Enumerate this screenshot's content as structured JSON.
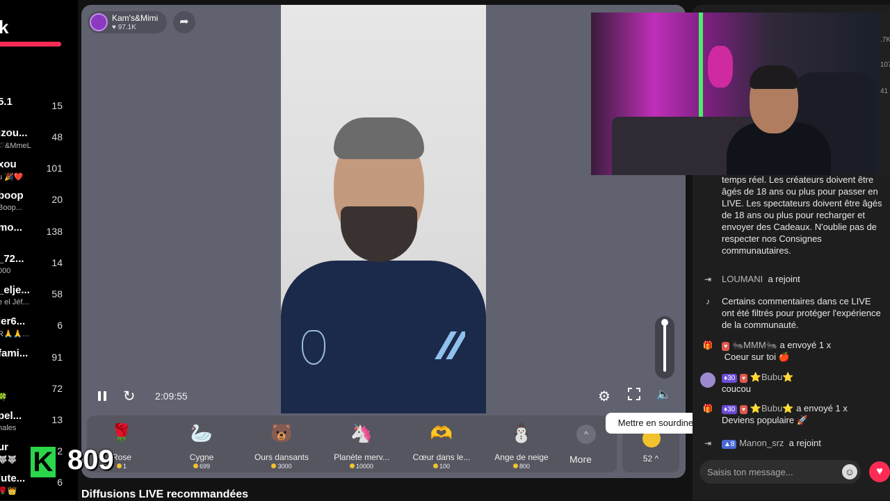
{
  "sidebar": {
    "logo": "k",
    "items": [
      {
        "name": "5.1",
        "sub": "",
        "count": "15"
      },
      {
        "name": "izou...",
        "sub": "♡&MmeL",
        "count": "48"
      },
      {
        "name": "xou",
        "sub": "u 🎉❤️",
        "count": "101"
      },
      {
        "name": "boop",
        "sub": "Boop...",
        "count": "20"
      },
      {
        "name": "mo...",
        "sub": "",
        "count": "138"
      },
      {
        "name": "_72...",
        "sub": "000",
        "count": "14"
      },
      {
        "name": "_elje...",
        "sub": "e el Jéf...",
        "count": "58"
      },
      {
        "name": "ier6...",
        "sub": "R🙏🙏...",
        "count": "6"
      },
      {
        "name": "fami...",
        "sub": "",
        "count": "91"
      },
      {
        "name": "",
        "sub": "🍀",
        "count": "72"
      },
      {
        "name": "pel...",
        "sub": "nales",
        "count": "13"
      },
      {
        "name": "ur",
        "sub": "🐺🐺",
        "count": "2"
      },
      {
        "name": "lute...",
        "sub": "🌹👑",
        "count": "6"
      }
    ],
    "overlay_badge": "K",
    "overlay_number": "809"
  },
  "video": {
    "host_name": "Kam's&Mimi",
    "host_likes": "97.1K",
    "time": "2:09:55",
    "tooltip": "Mettre en sourdine (M)",
    "volume_level": 1.0
  },
  "gifts": [
    {
      "name": "Rose",
      "price": "1",
      "icon": "🌹"
    },
    {
      "name": "Cygne",
      "price": "699",
      "icon": "🦢"
    },
    {
      "name": "Ours dansants",
      "price": "3000",
      "icon": "🐻"
    },
    {
      "name": "Planète merv...",
      "price": "10000",
      "icon": "🦄"
    },
    {
      "name": "Cœur dans le...",
      "price": "100",
      "icon": "🫶"
    },
    {
      "name": "Ange de neige",
      "price": "800",
      "icon": "⛄"
    }
  ],
  "gift_more": {
    "up_icon": "^",
    "label": "More",
    "count": "52 ^"
  },
  "recommended_title": "Diffusions LIVE recommandées",
  "chat": {
    "rules_partial": "a interagir avec d'autres personnes en temps réel. Les créateurs doivent être âgés de 18 ans ou plus pour passer en LIVE. Les spectateurs doivent être âgés de 18 ans ou plus pour recharger et envoyer des Cadeaux. N'oublie pas de respecter nos Consignes communautaires.",
    "messages": [
      {
        "type": "join",
        "user": "LOUMANI",
        "text": "a rejoint"
      },
      {
        "type": "system",
        "text": "Certains commentaires dans ce LIVE ont été filtrés pour protéger l'expérience de la communauté."
      },
      {
        "type": "gift",
        "user": "🐜MMM🐜",
        "text": "a envoyé 1 x",
        "gift": "Coeur sur toi 🍎"
      },
      {
        "type": "comment",
        "level": "30",
        "user": "⭐Bubu⭐",
        "text": "coucou"
      },
      {
        "type": "gift",
        "level": "30",
        "user": "⭐Bubu⭐",
        "text": "a envoyé 1 x",
        "gift": "Deviens populaire 🚀"
      },
      {
        "type": "join",
        "level": "8",
        "user": "Manon_srz",
        "text": "a rejoint"
      }
    ],
    "input_placeholder": "Saisis ton message...",
    "edge_numbers": [
      ".7K",
      "107",
      "41"
    ]
  }
}
